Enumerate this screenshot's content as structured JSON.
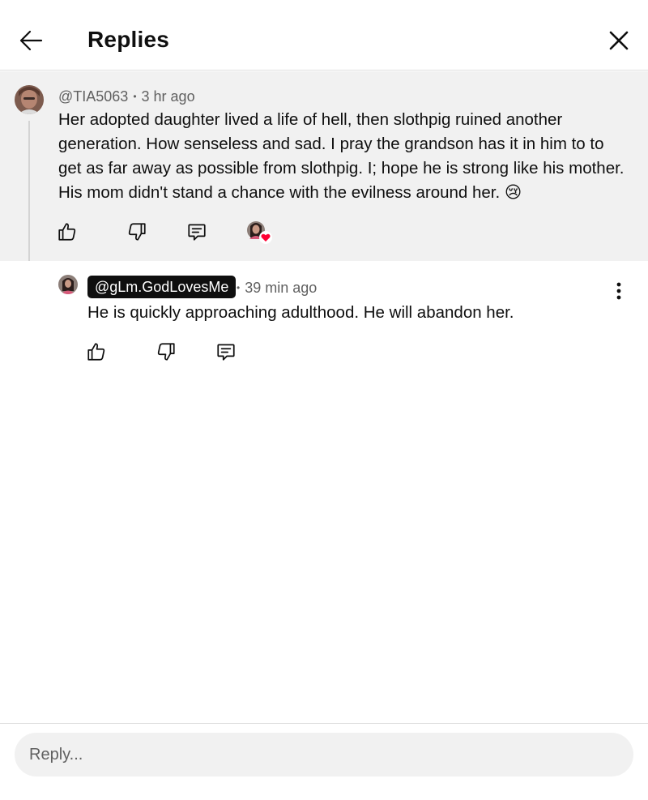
{
  "header": {
    "title": "Replies"
  },
  "parent_comment": {
    "author": "@TIA5063",
    "time": "3 hr ago",
    "text": "Her adopted daughter lived a life of hell, then slothpig ruined another generation. How senseless and sad. I pray the grandson has it in him to to get as far away as possible from slothpig.  I; hope he is strong like his mother. His mom didn't stand a chance with the evilness around her. 😢",
    "creator_heart": true
  },
  "reply_comment": {
    "author": "@gLm.GodLovesMe",
    "time": "39 min ago",
    "text": "He is quickly approaching adulthood. He will abandon her."
  },
  "separator": "•",
  "reply_box": {
    "placeholder": "Reply..."
  },
  "colors": {
    "heart": "#ff0033",
    "badge_bg": "#0f0f0f",
    "panel_bg": "#f1f1f1"
  },
  "icons": [
    "back-arrow-icon",
    "close-icon",
    "thumbs-up-icon",
    "thumbs-down-icon",
    "comment-icon",
    "kebab-menu-icon",
    "heart-icon"
  ]
}
